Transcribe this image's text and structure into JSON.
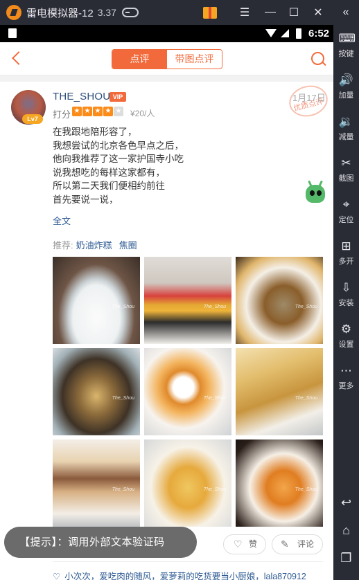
{
  "emulator": {
    "title": "雷电模拟器-12",
    "version": "3.37",
    "sidebar": [
      {
        "label": "按键",
        "icon": "keyboard-icon"
      },
      {
        "label": "加量",
        "icon": "volume-up-icon"
      },
      {
        "label": "减量",
        "icon": "volume-down-icon"
      },
      {
        "label": "截图",
        "icon": "scissors-icon"
      },
      {
        "label": "定位",
        "icon": "location-pin-icon"
      },
      {
        "label": "多开",
        "icon": "multi-window-icon"
      },
      {
        "label": "安装",
        "icon": "apk-install-icon"
      },
      {
        "label": "设置",
        "icon": "gear-icon"
      },
      {
        "label": "更多",
        "icon": "more-dots-icon"
      }
    ]
  },
  "status_bar": {
    "time": "6:52"
  },
  "app": {
    "tabs": [
      "点评",
      "带图点评"
    ],
    "active_tab": 0,
    "review": {
      "username": "THE_SHOU",
      "vip": "VIP",
      "level": "Lv7",
      "rating_label": "打分",
      "stars": 4,
      "stars_max": 5,
      "price": "¥20/人",
      "date": "1月17日",
      "stamp": "优质点评",
      "text_lines": [
        "在我跟地陪形容了，",
        "我想尝试的北京各色早点之后，",
        "他向我推荐了这一家护国寺小吃",
        "说我想吃的每样这家都有，",
        "所以第二天我们便相约前往",
        "首先要说一说，"
      ],
      "fulltext_link": "全文",
      "recommend_label": "推荐:",
      "recommend_dishes": [
        "奶油炸糕",
        "焦圈"
      ],
      "photo_watermark": "The_Shou",
      "photos": [
        {
          "name": "photo-tofu-soup"
        },
        {
          "name": "photo-layered-cake"
        },
        {
          "name": "photo-douzhi-bowl"
        },
        {
          "name": "photo-stew-bowl"
        },
        {
          "name": "photo-fried-ring"
        },
        {
          "name": "photo-fried-pancake"
        },
        {
          "name": "photo-stuffed-pancake"
        },
        {
          "name": "photo-cream-fritter"
        },
        {
          "name": "photo-fried-rings-plate"
        }
      ],
      "like_label": "赞",
      "comment_label": "评论",
      "likers": "小次次，爱吃肉的随风，爱萝莉的吃货要当小厨娘，lala870912"
    }
  },
  "toast": "【提示】：调用外部文本验证码"
}
